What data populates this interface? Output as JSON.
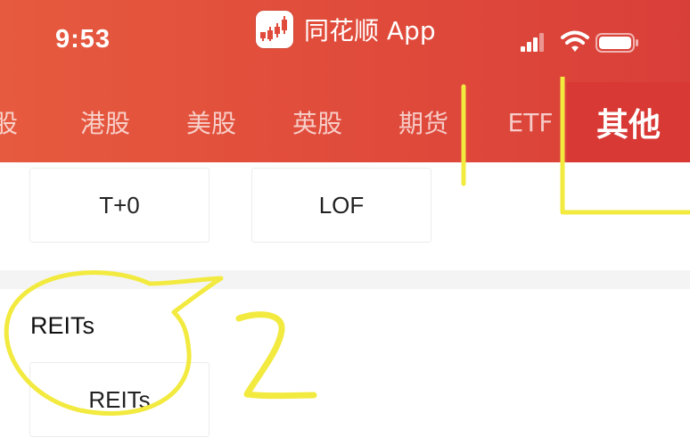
{
  "status_bar": {
    "time": "9:53",
    "app_name": "同花顺 App",
    "icons": [
      "signal-icon",
      "wifi-icon",
      "battery-icon"
    ]
  },
  "tabs": [
    {
      "label": "股",
      "active": false
    },
    {
      "label": "港股",
      "active": false
    },
    {
      "label": "美股",
      "active": false
    },
    {
      "label": "英股",
      "active": false
    },
    {
      "label": "期货",
      "active": false
    },
    {
      "label": "ETF",
      "active": false
    },
    {
      "label": "其他",
      "active": true
    }
  ],
  "content": {
    "chips": [
      "T+0",
      "LOF"
    ],
    "section": {
      "title": "REITs",
      "chips": [
        "REITs"
      ]
    }
  },
  "annotations": {
    "number_label": "2",
    "color": "#f2ea3f"
  },
  "colors": {
    "header_start": "#e65a3f",
    "header_end": "#d93f39",
    "active_tab": "#d83935",
    "divider": "#f4f4f4"
  }
}
